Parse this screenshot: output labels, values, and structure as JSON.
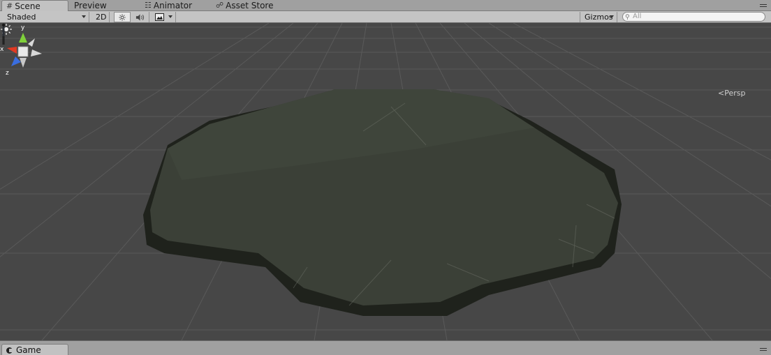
{
  "tabs": [
    {
      "label": "Scene",
      "icon": "grid-icon",
      "active": true
    },
    {
      "label": "Preview",
      "icon": "",
      "active": false
    },
    {
      "label": "Animator",
      "icon": "animator-icon",
      "active": false
    },
    {
      "label": "Asset Store",
      "icon": "store-icon",
      "active": false
    }
  ],
  "toolbar": {
    "draw_mode": "Shaded",
    "mode_2d": "2D",
    "lighting_icon": "sun-icon",
    "audio_icon": "speaker-icon",
    "effects_icon": "image-icon",
    "gizmos": "Gizmos",
    "search_placeholder": "All"
  },
  "scene": {
    "projection_label": "Persp",
    "gizmo_axes": {
      "x": "x",
      "y": "y",
      "z": "z"
    },
    "colors": {
      "background": "#474747",
      "grid": "#5e5e5e",
      "terrain_top": "#3a3f37",
      "terrain_side": "#262922",
      "x_axis": "#e03a22",
      "y_axis": "#7fd03a",
      "z_axis": "#3a6ee0"
    }
  },
  "bottom": {
    "game_tab": "Game"
  }
}
